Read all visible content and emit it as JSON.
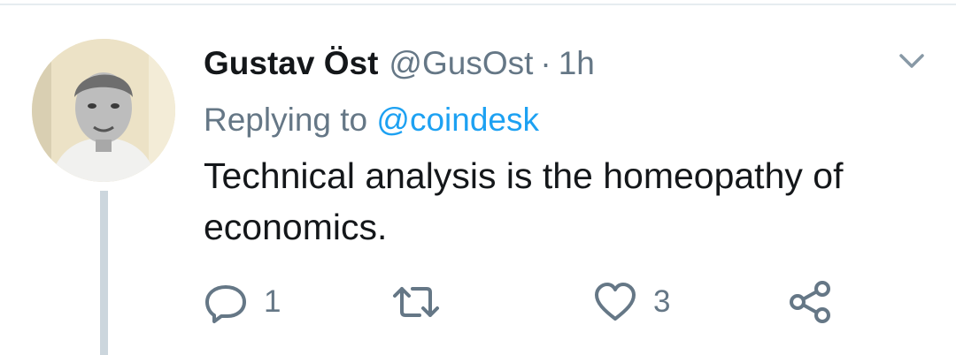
{
  "tweet": {
    "author_name": "Gustav Öst",
    "handle": "@GusOst",
    "separator": "·",
    "time": "1h",
    "replying_prefix": "Replying to ",
    "replying_mention": "@coindesk",
    "text": "Technical analysis is the homeopathy of economics."
  },
  "actions": {
    "reply": {
      "icon": "reply-icon",
      "count": "1"
    },
    "retweet": {
      "icon": "retweet-icon",
      "count": ""
    },
    "like": {
      "icon": "heart-icon",
      "count": "3"
    },
    "share": {
      "icon": "share-icon"
    }
  },
  "colors": {
    "text_primary": "#14171a",
    "text_secondary": "#657786",
    "link": "#1da1f2",
    "thread_line": "#ccd6dd",
    "icon_gray": "#657786"
  }
}
